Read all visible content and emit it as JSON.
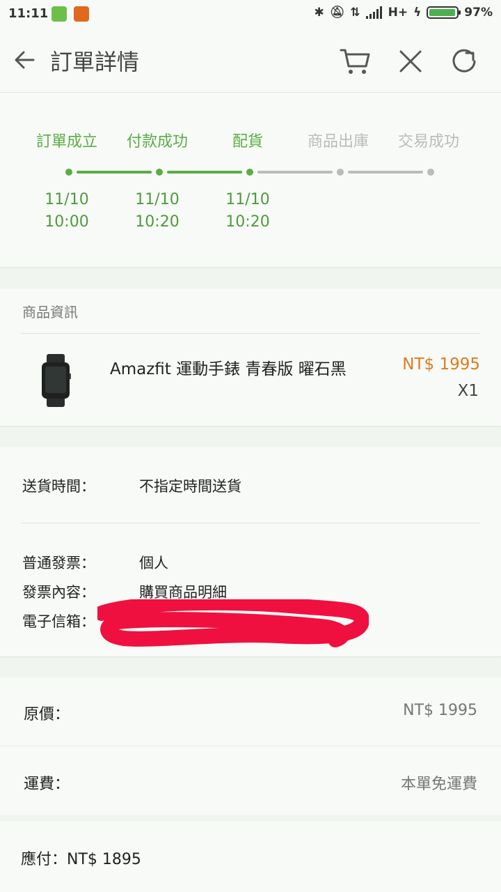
{
  "status_bar": {
    "time": "11:11",
    "network": "H+",
    "battery": "97%",
    "battery_level": 0.97
  },
  "header": {
    "title": "訂單詳情",
    "icons": [
      "back-arrow-icon",
      "cart-icon",
      "close-icon",
      "refresh-icon"
    ]
  },
  "progress": {
    "steps": [
      {
        "label": "訂單成立",
        "date": "11/10",
        "time": "10:00",
        "done": true
      },
      {
        "label": "付款成功",
        "date": "11/10",
        "time": "10:20",
        "done": true
      },
      {
        "label": "配貨",
        "date": "11/10",
        "time": "10:20",
        "done": true
      },
      {
        "label": "商品出庫",
        "date": "",
        "time": "",
        "done": false
      },
      {
        "label": "交易成功",
        "date": "",
        "time": "",
        "done": false
      }
    ],
    "active_color": "#5bac46",
    "inactive_color": "#b9bcb8"
  },
  "product": {
    "section_title": "商品資訊",
    "name": "Amazfit 運動手錶 青春版 曜石黑",
    "price": "NT$ 1995",
    "quantity": "X1",
    "price_color": "#e07b1e"
  },
  "delivery": {
    "time_label": "送貨時間：",
    "time_value": "不指定時間送貨",
    "invoice_label": "普通發票：",
    "invoice_value": "個人",
    "content_label": "發票內容：",
    "content_value": "購買商品明細",
    "email_label": "電子信箱：",
    "redaction_color": "#f0103f"
  },
  "pricing": {
    "original_label": "原價：",
    "original_value": "NT$ 1995",
    "shipping_label": "運費：",
    "shipping_value": "本單免運費",
    "total": "應付：NT$ 1895"
  }
}
